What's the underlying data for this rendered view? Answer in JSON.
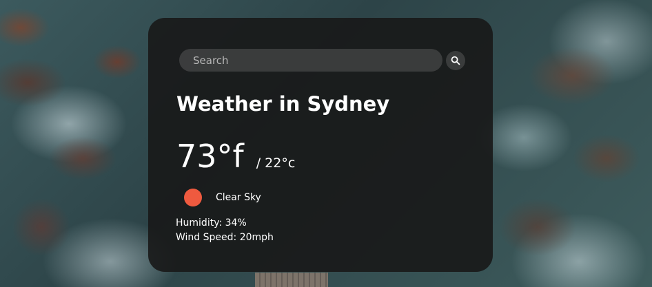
{
  "search": {
    "placeholder": "Search",
    "value": "",
    "button_icon": "search-icon"
  },
  "weather": {
    "title": "Weather in Sydney",
    "temp_f": "73°f",
    "temp_c": "/ 22°c",
    "description": "Clear Sky",
    "condition_icon": "sun-icon",
    "condition_color": "#ef5a3f",
    "humidity": "Humidity: 34%",
    "wind": "Wind Speed: 20mph"
  }
}
